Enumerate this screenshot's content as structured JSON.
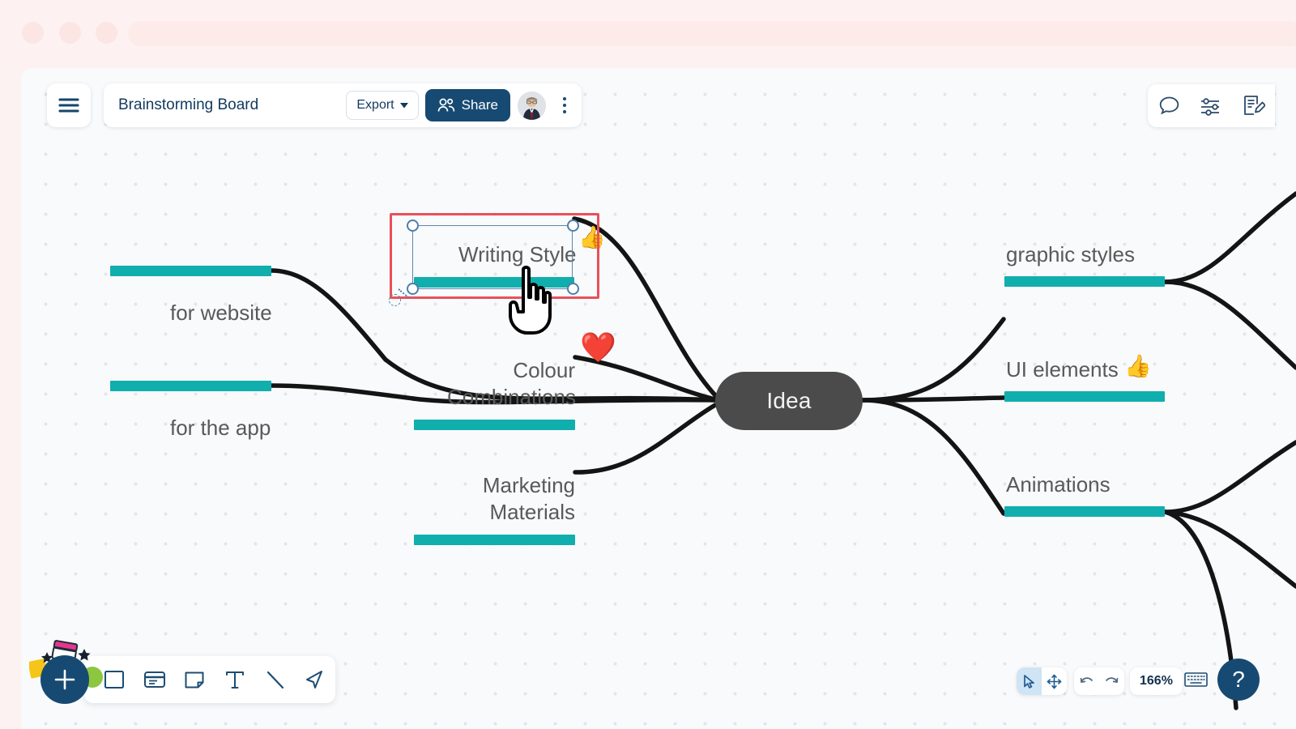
{
  "window": {
    "chrome_bg": "#fdf1f1",
    "traffic_lights": [
      "close",
      "minimize",
      "maximize"
    ]
  },
  "header": {
    "menu_icon": "hamburger-icon",
    "board_title": "Brainstorming Board",
    "export_label": "Export",
    "export_caret_icon": "caret-down-icon",
    "share_label": "Share",
    "share_icon": "people-icon",
    "share_bg": "#174a72",
    "avatar_icon": "user-avatar",
    "more_icon": "vertical-dots-icon"
  },
  "context_toolbar": {
    "items": [
      {
        "icon": "text-cursor-icon",
        "name": "text-format"
      },
      {
        "icon": "connector-icon",
        "name": "connector"
      },
      {
        "icon": "emoji-face-icon",
        "name": "emoji-picker"
      },
      {
        "icon": "attachment-link-icon",
        "name": "attachment"
      },
      {
        "icon": "vertical-dots-icon",
        "name": "more-options"
      }
    ]
  },
  "top_right_tools": [
    {
      "icon": "comment-bubble-icon",
      "name": "comments"
    },
    {
      "icon": "sliders-icon",
      "name": "board-settings"
    },
    {
      "icon": "note-edit-icon",
      "name": "notes"
    }
  ],
  "canvas": {
    "background": "#f9fafb",
    "dot_color": "#e2e5e9",
    "node_accent": "#11aeae",
    "center_node_bg": "#4b4b4b",
    "selection_color": "#e8505b",
    "handle_color": "#4e7fab"
  },
  "mindmap": {
    "center": {
      "label": "Idea"
    },
    "left_branches": [
      {
        "label": "for website",
        "emoji": ""
      },
      {
        "label": "for the app",
        "emoji": ""
      },
      {
        "label": "Writing Style",
        "emoji": "👍",
        "selected": true
      },
      {
        "label": "Colour Combinations",
        "emoji": "❤️"
      },
      {
        "label": "Marketing Materials",
        "emoji": ""
      }
    ],
    "right_branches": [
      {
        "label": "graphic styles",
        "emoji": ""
      },
      {
        "label": "UI elements",
        "emoji": "👍"
      },
      {
        "label": "Animations",
        "emoji": ""
      }
    ]
  },
  "bottom_toolbar": {
    "add_label": "+",
    "items": [
      {
        "icon": "square-shape-icon",
        "name": "shape-rectangle"
      },
      {
        "icon": "card-icon",
        "name": "card"
      },
      {
        "icon": "sticky-note-icon",
        "name": "sticky-note"
      },
      {
        "icon": "text-icon",
        "name": "text"
      },
      {
        "icon": "line-icon",
        "name": "line"
      },
      {
        "icon": "marker-pen-icon",
        "name": "marker"
      }
    ]
  },
  "bottom_right": {
    "select_tool_icon": "cursor-arrow-icon",
    "pan_tool_icon": "move-arrows-icon",
    "undo_icon": "undo-arrow-icon",
    "redo_icon": "redo-arrow-icon",
    "zoom_level": "166%",
    "keyboard_icon": "keyboard-icon",
    "help_label": "?"
  }
}
